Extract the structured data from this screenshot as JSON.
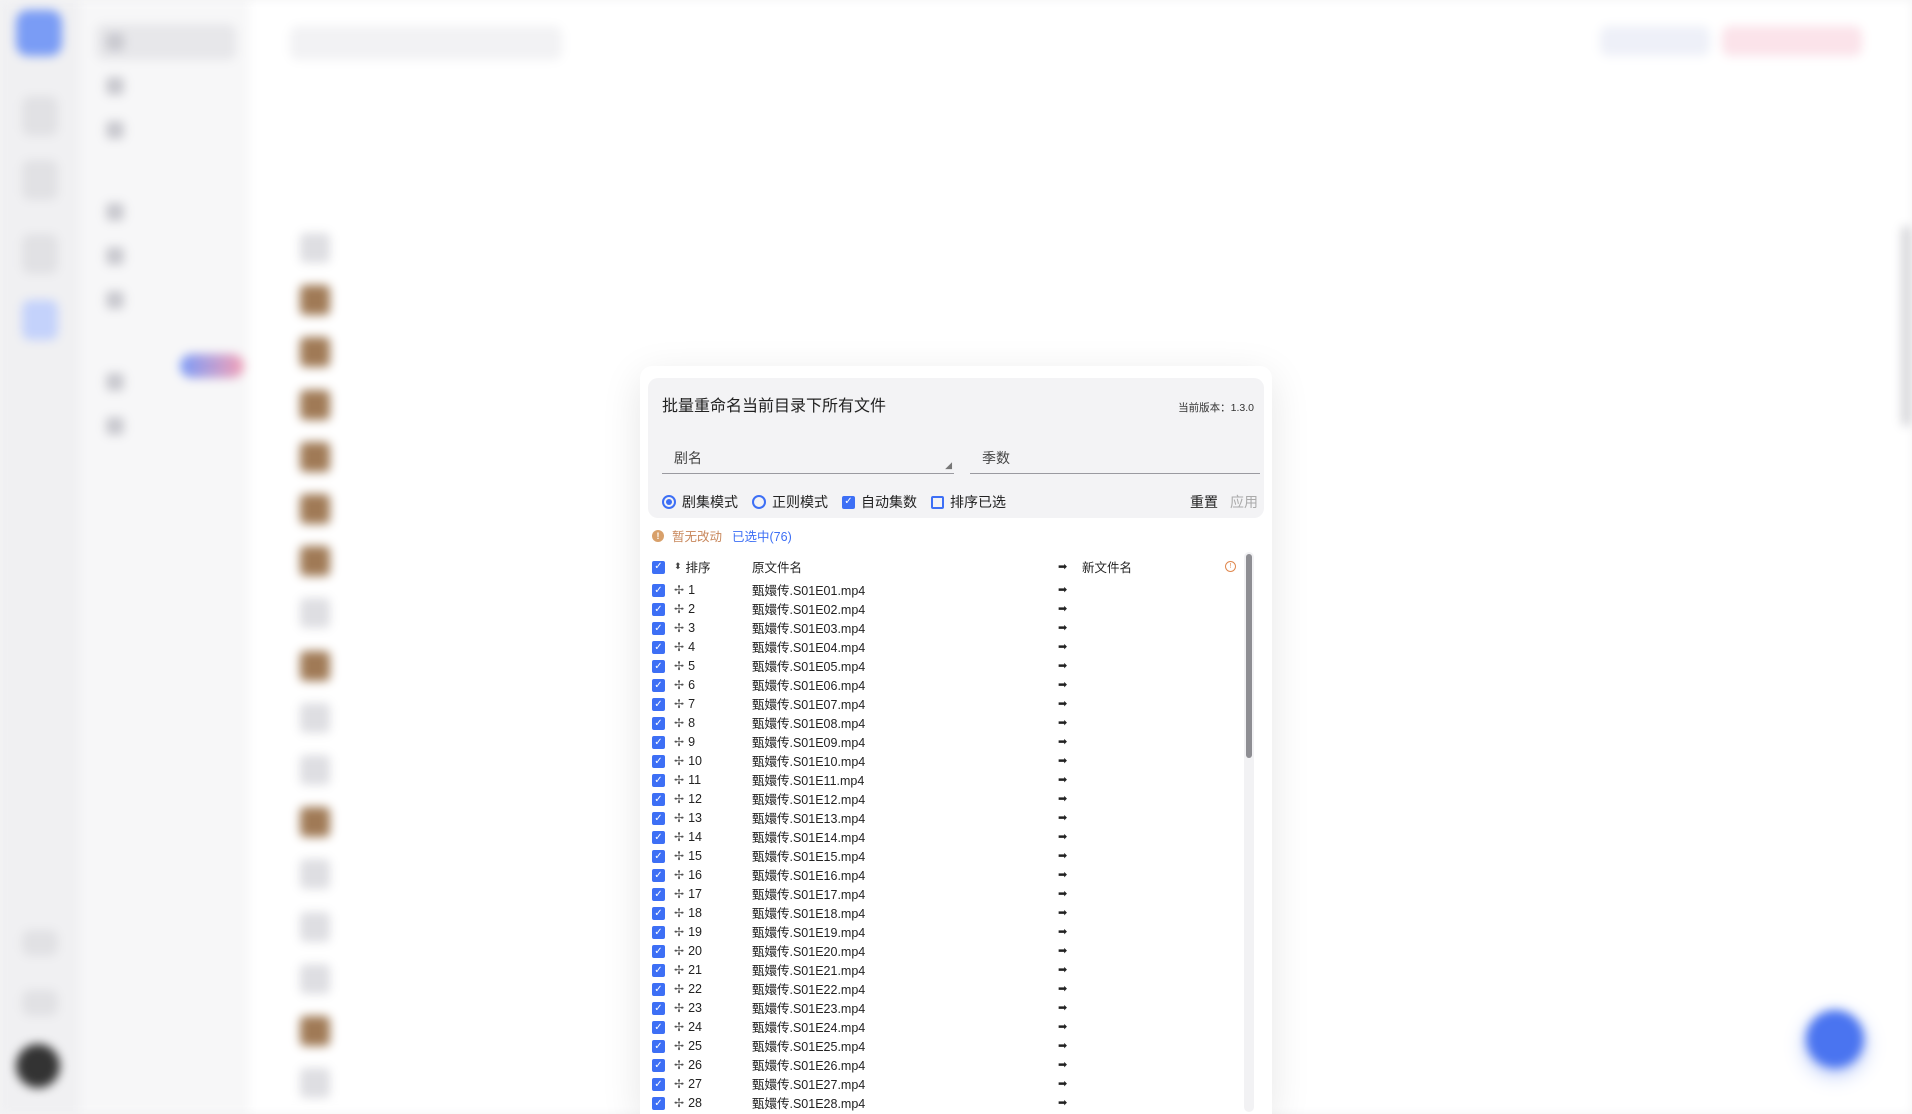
{
  "modal": {
    "title": "批量重命名当前目录下所有文件",
    "version": "当前版本：1.3.0",
    "show_name_placeholder": "剧名",
    "season_placeholder": "季数",
    "options": {
      "episode_mode": "剧集模式",
      "regex_mode": "正则模式",
      "auto_episode": "自动集数",
      "sort_selected": "排序已选",
      "reset": "重置",
      "apply": "应用"
    },
    "status": {
      "no_changes": "暂无改动",
      "selected": "已选中(76)"
    },
    "columns": {
      "order": "排序",
      "original": "原文件名",
      "arrow": "➡",
      "new": "新文件名"
    },
    "rows": [
      {
        "order": "1",
        "original": "甄嬛传.S01E01.mp4",
        "arrow": "➡"
      },
      {
        "order": "2",
        "original": "甄嬛传.S01E02.mp4",
        "arrow": "➡"
      },
      {
        "order": "3",
        "original": "甄嬛传.S01E03.mp4",
        "arrow": "➡"
      },
      {
        "order": "4",
        "original": "甄嬛传.S01E04.mp4",
        "arrow": "➡"
      },
      {
        "order": "5",
        "original": "甄嬛传.S01E05.mp4",
        "arrow": "➡"
      },
      {
        "order": "6",
        "original": "甄嬛传.S01E06.mp4",
        "arrow": "➡"
      },
      {
        "order": "7",
        "original": "甄嬛传.S01E07.mp4",
        "arrow": "➡"
      },
      {
        "order": "8",
        "original": "甄嬛传.S01E08.mp4",
        "arrow": "➡"
      },
      {
        "order": "9",
        "original": "甄嬛传.S01E09.mp4",
        "arrow": "➡"
      },
      {
        "order": "10",
        "original": "甄嬛传.S01E10.mp4",
        "arrow": "➡"
      },
      {
        "order": "11",
        "original": "甄嬛传.S01E11.mp4",
        "arrow": "➡"
      },
      {
        "order": "12",
        "original": "甄嬛传.S01E12.mp4",
        "arrow": "➡"
      },
      {
        "order": "13",
        "original": "甄嬛传.S01E13.mp4",
        "arrow": "➡"
      },
      {
        "order": "14",
        "original": "甄嬛传.S01E14.mp4",
        "arrow": "➡"
      },
      {
        "order": "15",
        "original": "甄嬛传.S01E15.mp4",
        "arrow": "➡"
      },
      {
        "order": "16",
        "original": "甄嬛传.S01E16.mp4",
        "arrow": "➡"
      },
      {
        "order": "17",
        "original": "甄嬛传.S01E17.mp4",
        "arrow": "➡"
      },
      {
        "order": "18",
        "original": "甄嬛传.S01E18.mp4",
        "arrow": "➡"
      },
      {
        "order": "19",
        "original": "甄嬛传.S01E19.mp4",
        "arrow": "➡"
      },
      {
        "order": "20",
        "original": "甄嬛传.S01E20.mp4",
        "arrow": "➡"
      },
      {
        "order": "21",
        "original": "甄嬛传.S01E21.mp4",
        "arrow": "➡"
      },
      {
        "order": "22",
        "original": "甄嬛传.S01E22.mp4",
        "arrow": "➡"
      },
      {
        "order": "23",
        "original": "甄嬛传.S01E23.mp4",
        "arrow": "➡"
      },
      {
        "order": "24",
        "original": "甄嬛传.S01E24.mp4",
        "arrow": "➡"
      },
      {
        "order": "25",
        "original": "甄嬛传.S01E25.mp4",
        "arrow": "➡"
      },
      {
        "order": "26",
        "original": "甄嬛传.S01E26.mp4",
        "arrow": "➡"
      },
      {
        "order": "27",
        "original": "甄嬛传.S01E27.mp4",
        "arrow": "➡"
      },
      {
        "order": "28",
        "original": "甄嬛传.S01E28.mp4",
        "arrow": "➡"
      }
    ]
  },
  "icons": {
    "radio_selected": "radio-checked-icon",
    "checkbox_checked": "check-icon",
    "drag": "drag-handle-icon",
    "sort": "sort-icon",
    "warn": "warning-icon",
    "info": "info-icon"
  },
  "colors": {
    "accent": "#3d6ff5",
    "warning_text": "#c8875b",
    "fab": "#4a74f0"
  }
}
